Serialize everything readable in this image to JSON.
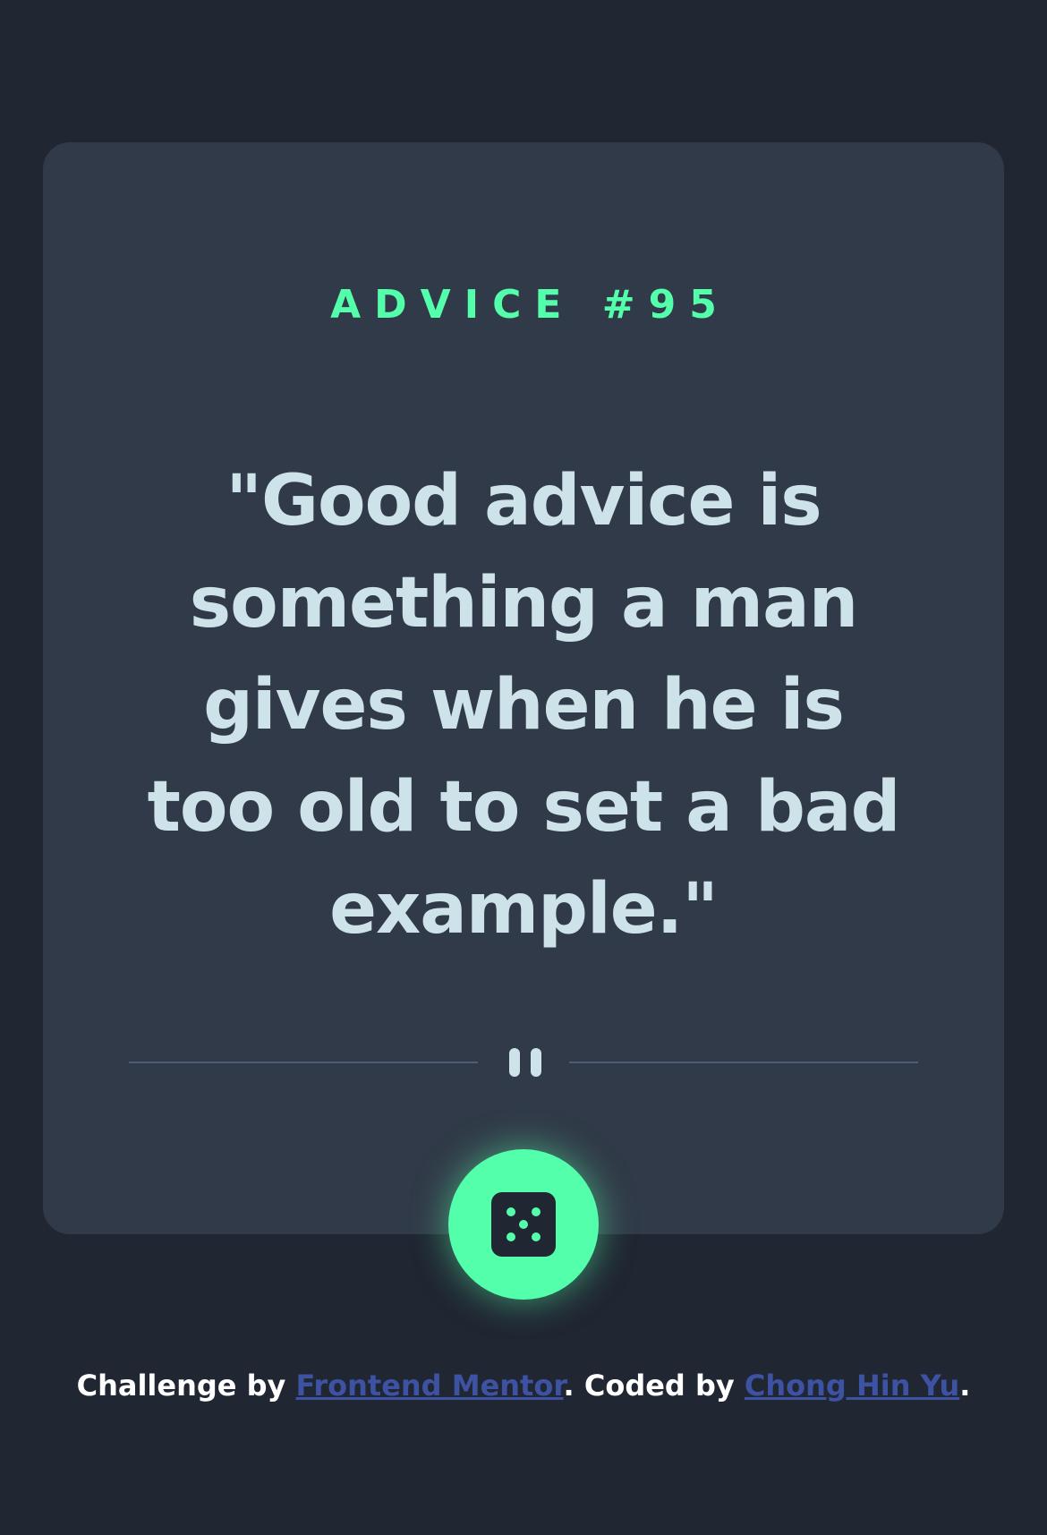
{
  "advice": {
    "title": "ADVICE #95",
    "quote": "\"Good advice is something a man gives when he is too old to set a bad example.\""
  },
  "colors": {
    "background": "#202632",
    "card": "#313A48",
    "accent": "#53FFAA",
    "quote_text": "#CEE3E9",
    "divider": "#4F5D74",
    "link": "#3E52A3"
  },
  "icons": {
    "divider_icon": "pause-icon",
    "button_icon": "dice-icon"
  },
  "footer": {
    "prefix": "Challenge by ",
    "link1": "Frontend Mentor",
    "middle": ". Coded by ",
    "link2": "Chong Hin Yu",
    "suffix": "."
  }
}
